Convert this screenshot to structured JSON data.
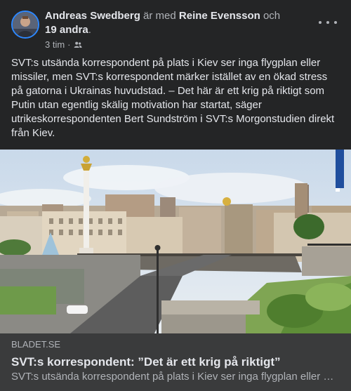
{
  "post": {
    "author": "Andreas Swedberg",
    "with_text": " är med ",
    "tagged": "Reine Evensson",
    "and_text": " och",
    "others": "19 andra",
    "period": ".",
    "time": "3 tim",
    "separator": "·",
    "audience_icon": "friends-icon",
    "more_icon": "more-icon",
    "text": "SVT:s utsända korrespondent på plats i Kiev ser inga flygplan eller missiler, men SVT:s korrespondent märker istället av en ökad stress på gatorna i Ukrainas huvudstad. – Det här är ett krig på riktigt som Putin utan egentlig skälig motivation har startat, säger utrikeskorrespondenten Bert Sundström i SVT:s Morgonstudien direkt från Kiev."
  },
  "link": {
    "domain": "BLADET.SE",
    "title": "SVT:s korrespondent: ”Det är ett krig på riktigt”",
    "description": "SVT:s utsända korrespondent på plats i Kiev ser inga flygplan eller missiler, men SVT:s korrespondent märker istället av en ökad stress på gatorna i Ukrainas huvudstad."
  },
  "colors": {
    "background": "#242526",
    "card": "#3a3b3c",
    "primary_text": "#e4e6eb",
    "secondary_text": "#b0b3b8",
    "accent": "#2d88ff"
  }
}
